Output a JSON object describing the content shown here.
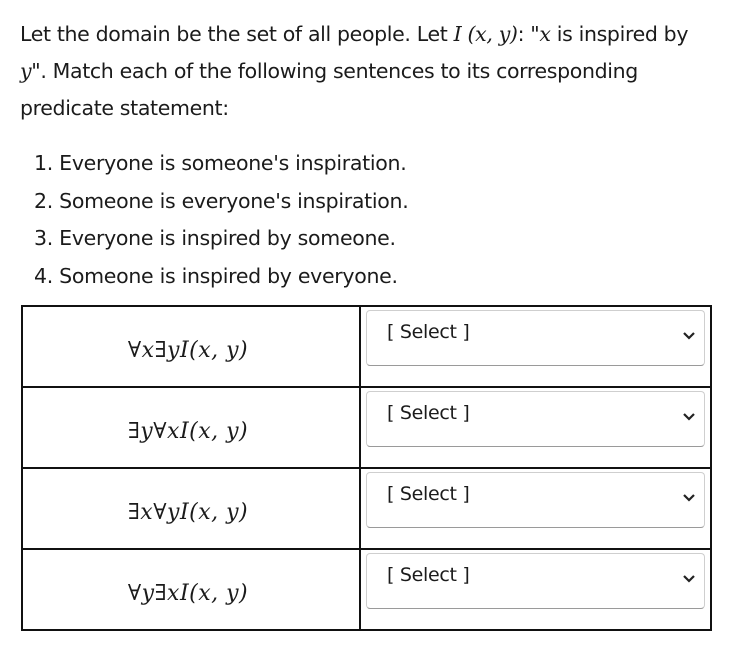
{
  "intro": {
    "part1": "Let the domain be the set of all people. Let ",
    "predicate_name": "I",
    "predicate_args": "(x, y)",
    "part2": ": \"",
    "var_x": "x",
    "part3": " is inspired by ",
    "var_y": "y",
    "part4": "\". Match each of the following sentences to its corresponding predicate statement:"
  },
  "sentences": [
    "1. Everyone is someone's inspiration.",
    "2. Someone is everyone's inspiration.",
    "3. Everyone is inspired by someone.",
    "4. Someone is inspired by everyone."
  ],
  "rows": [
    {
      "statement": {
        "q1": "∀",
        "v1": "x",
        "q2": "∃",
        "v2": "y",
        "pred": "I",
        "args": "(x, y)"
      },
      "select": {
        "selected": "[ Select ]",
        "icon": "chevron-down-icon"
      }
    },
    {
      "statement": {
        "q1": "∃",
        "v1": "y",
        "q2": "∀",
        "v2": "x",
        "pred": "I",
        "args": "(x, y)"
      },
      "select": {
        "selected": "[ Select ]",
        "icon": "chevron-down-icon"
      }
    },
    {
      "statement": {
        "q1": "∃",
        "v1": "x",
        "q2": "∀",
        "v2": "y",
        "pred": "I",
        "args": "(x, y)"
      },
      "select": {
        "selected": "[ Select ]",
        "icon": "chevron-down-icon"
      }
    },
    {
      "statement": {
        "q1": "∀",
        "v1": "y",
        "q2": "∃",
        "v2": "x",
        "pred": "I",
        "args": "(x, y)"
      },
      "select": {
        "selected": "[ Select ]",
        "icon": "chevron-down-icon"
      }
    }
  ]
}
